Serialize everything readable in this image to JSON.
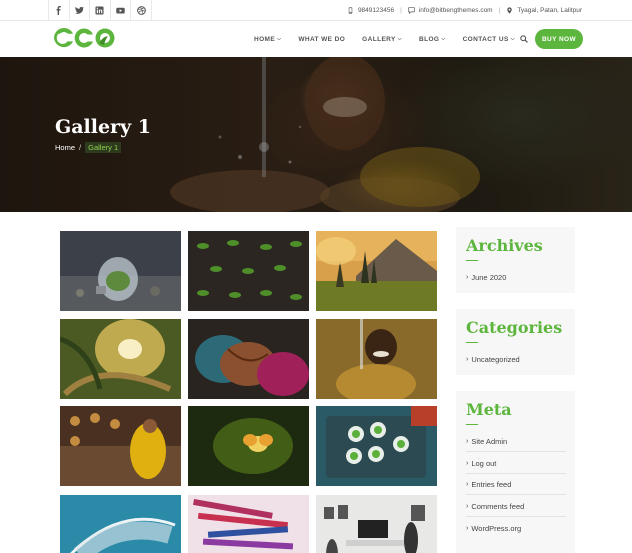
{
  "topbar": {
    "social": [
      {
        "name": "facebook-icon"
      },
      {
        "name": "twitter-icon"
      },
      {
        "name": "linkedin-icon"
      },
      {
        "name": "youtube-icon"
      },
      {
        "name": "dribbble-icon"
      }
    ],
    "phone": "9849123456",
    "email": "info@bitbengthemes.com",
    "address": "Tyagal, Patan, Lalitpur"
  },
  "header": {
    "logo_text": "eco",
    "nav": [
      {
        "label": "HOME",
        "dropdown": true
      },
      {
        "label": "WHAT WE DO",
        "dropdown": false
      },
      {
        "label": "GALLERY",
        "dropdown": true
      },
      {
        "label": "BLOG",
        "dropdown": true
      },
      {
        "label": "CONTACT US",
        "dropdown": true
      }
    ],
    "buy_label": "BUY NOW",
    "accent": "#5cb63d"
  },
  "banner": {
    "title": "Gallery 1",
    "breadcrumb_home": "Home",
    "breadcrumb_sep": "/",
    "breadcrumb_current": "Gallery 1"
  },
  "gallery": {
    "images": [
      {
        "name": "lightbulb-plant"
      },
      {
        "name": "seedlings"
      },
      {
        "name": "mountain-sunset"
      },
      {
        "name": "sunlit-plant"
      },
      {
        "name": "henna-hands"
      },
      {
        "name": "child-water"
      },
      {
        "name": "monk-yellow"
      },
      {
        "name": "butterfly-light"
      },
      {
        "name": "plates-table"
      },
      {
        "name": "feather-blue"
      },
      {
        "name": "colored-pencils"
      },
      {
        "name": "gallery-room"
      }
    ]
  },
  "sidebar": {
    "archives": {
      "title": "Archives",
      "items": [
        "June 2020"
      ]
    },
    "categories": {
      "title": "Categories",
      "items": [
        "Uncategorized"
      ]
    },
    "meta": {
      "title": "Meta",
      "items": [
        "Site Admin",
        "Log out",
        "Entries feed",
        "Comments feed",
        "WordPress.org"
      ]
    }
  }
}
